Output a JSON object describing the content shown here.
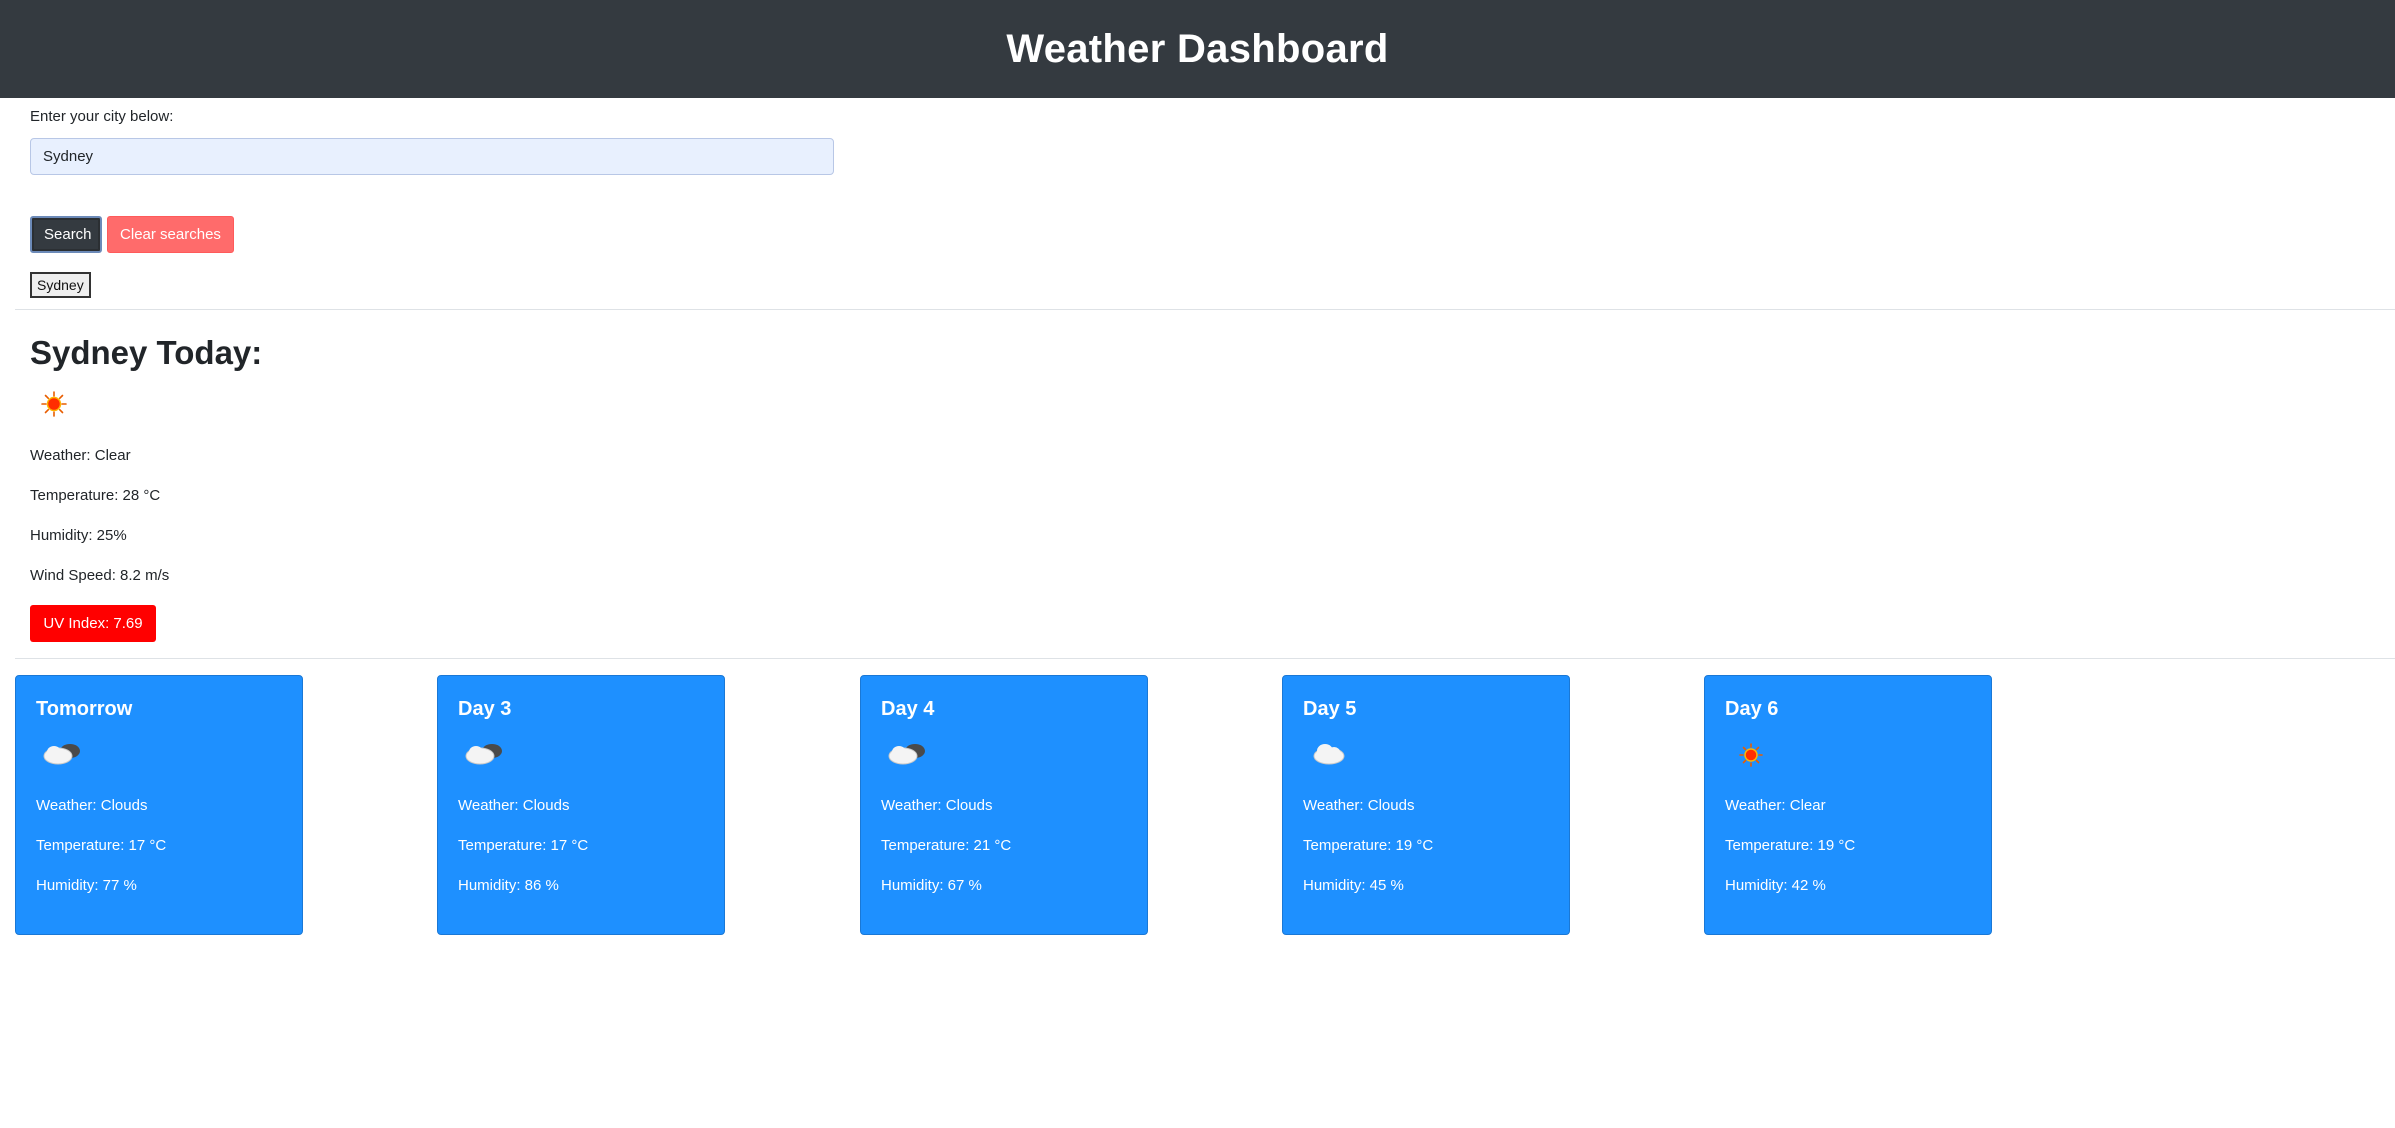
{
  "header": {
    "title": "Weather Dashboard"
  },
  "search": {
    "label": "Enter your city below:",
    "value": "Sydney",
    "search_button": "Search",
    "clear_button": "Clear searches",
    "history": [
      "Sydney"
    ]
  },
  "today": {
    "title": "Sydney Today:",
    "icon": "sun-icon",
    "weather": "Weather: Clear",
    "temperature": "Temperature: 28 °C",
    "humidity": "Humidity: 25%",
    "wind": "Wind Speed: 8.2 m/s",
    "uv": "UV Index: 7.69",
    "uv_color": "#ff0000"
  },
  "forecast": [
    {
      "title": "Tomorrow",
      "icon": "cloudy-icon",
      "weather": "Weather: Clouds",
      "temperature": "Temperature: 17 °C",
      "humidity": "Humidity: 77 %"
    },
    {
      "title": "Day 3",
      "icon": "cloudy-icon",
      "weather": "Weather: Clouds",
      "temperature": "Temperature: 17 °C",
      "humidity": "Humidity: 86 %"
    },
    {
      "title": "Day 4",
      "icon": "cloudy-icon",
      "weather": "Weather: Clouds",
      "temperature": "Temperature: 21 °C",
      "humidity": "Humidity: 67 %"
    },
    {
      "title": "Day 5",
      "icon": "cloud-icon",
      "weather": "Weather: Clouds",
      "temperature": "Temperature: 19 °C",
      "humidity": "Humidity: 45 %"
    },
    {
      "title": "Day 6",
      "icon": "sun-icon",
      "weather": "Weather: Clear",
      "temperature": "Temperature: 19 °C",
      "humidity": "Humidity: 42 %"
    }
  ],
  "colors": {
    "header_bg": "#343a40",
    "card_bg": "#1e90ff",
    "clear_button": "#ff6b6b",
    "uv_high": "#ff0000"
  }
}
